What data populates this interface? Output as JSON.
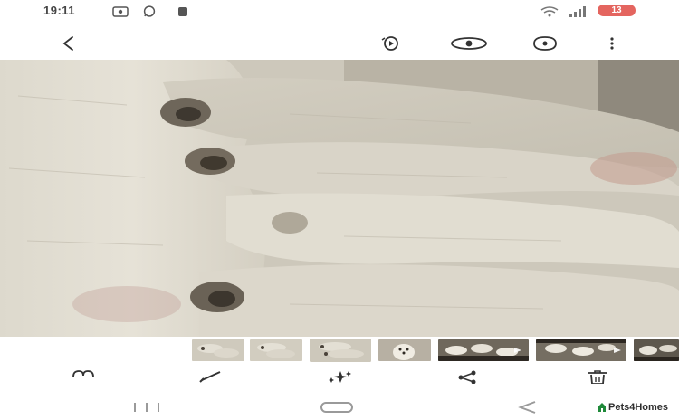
{
  "status_bar": {
    "time": "19:11",
    "icons": [
      "screenshot-icon",
      "whatsapp-icon",
      "notification-icon",
      "wifi-icon",
      "signal-icon"
    ],
    "battery_level": "13"
  },
  "toolbar": {
    "back_icon": "back-arrow-icon",
    "action_icons": [
      "motion-photo-icon",
      "view-icon",
      "remaster-icon",
      "more-options-icon"
    ]
  },
  "photo": {
    "subject": "sleeping-puppies-photo"
  },
  "filmstrip": {
    "thumbnails": [
      {
        "kind": "puppies-closeup",
        "active": false
      },
      {
        "kind": "puppies-closeup",
        "active": false
      },
      {
        "kind": "puppies-closeup",
        "active": true
      },
      {
        "kind": "puppy-portrait",
        "active": false
      },
      {
        "kind": "puppies-litter",
        "active": false
      },
      {
        "kind": "puppies-litter",
        "active": false
      },
      {
        "kind": "puppies-litter",
        "active": false
      }
    ]
  },
  "actions": {
    "icons": [
      "favorite-icon",
      "edit-icon",
      "ai-edit-icon",
      "share-icon",
      "delete-icon"
    ]
  },
  "navbar": {
    "icons": [
      "recents-icon",
      "home-icon",
      "back-icon"
    ]
  },
  "watermark": {
    "text": "Pets4Homes"
  },
  "colors": {
    "battery_badge": "#e4655f",
    "icon": "#3a3a3a",
    "nav_icon": "#9a9a9a"
  }
}
